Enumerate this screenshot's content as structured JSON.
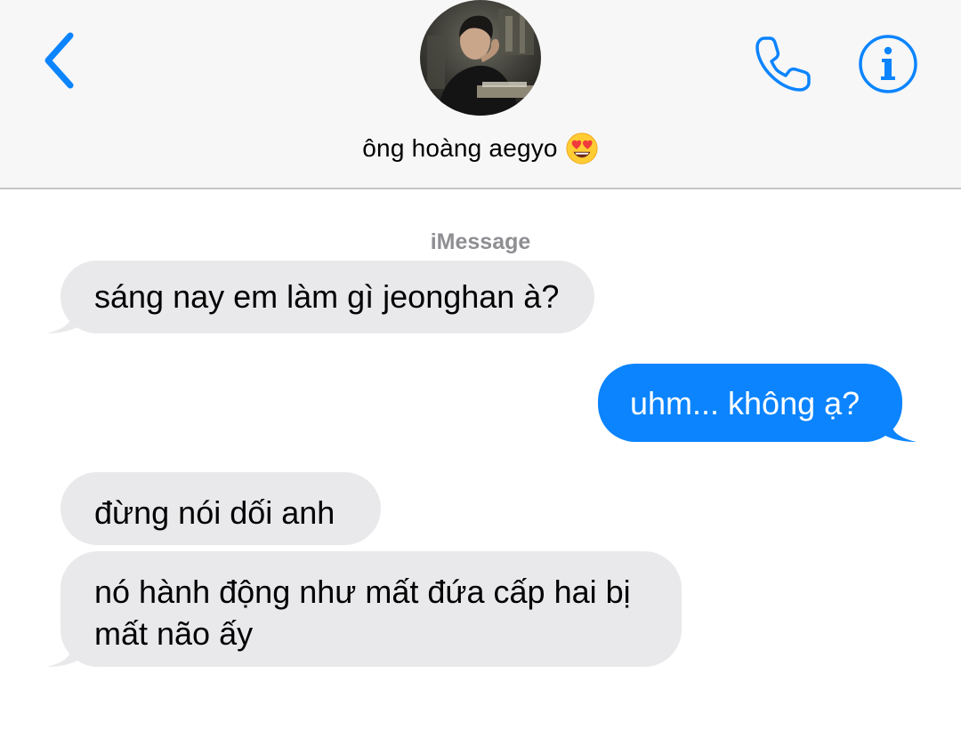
{
  "header": {
    "contact_name": "ông hoàng aegyo",
    "contact_emoji": "heart-eyes-emoji",
    "back_icon": "chevron-left-icon",
    "call_icon": "phone-icon",
    "info_icon": "info-icon"
  },
  "thread": {
    "service_label": "iMessage",
    "messages": [
      {
        "direction": "incoming",
        "text": "sáng nay em làm gì jeonghan à?"
      },
      {
        "direction": "outgoing",
        "text": "uhm... không ạ?"
      },
      {
        "direction": "incoming",
        "text": "đừng nói dối anh"
      },
      {
        "direction": "incoming",
        "text": "nó hành động như mất đứa cấp hai bị mất não ấy"
      }
    ]
  },
  "colors": {
    "accent": "#0b84fe",
    "incoming_bubble": "#e9e9eb",
    "header_bg": "#f7f7f7",
    "secondary_text": "#8e8e93"
  }
}
